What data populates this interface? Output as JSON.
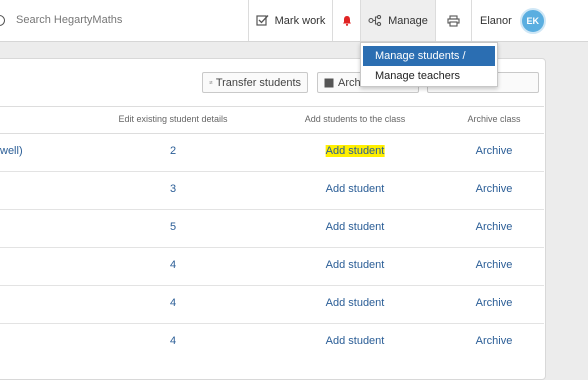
{
  "search": {
    "placeholder": "Search HegartyMaths"
  },
  "nav": {
    "mark_work": "Mark work",
    "manage": "Manage",
    "user_name": "Elanor",
    "user_initials": "EK"
  },
  "dropdown": {
    "items": [
      {
        "label": "Manage students / classes",
        "active": true
      },
      {
        "label": "Manage teachers",
        "active": false
      }
    ]
  },
  "toolbar": {
    "transfer_label": "Transfer students",
    "archive_label": "Archi"
  },
  "table": {
    "headers": [
      "Edit existing student details",
      "Add students to the class",
      "Archive class"
    ],
    "rows": [
      {
        "name": "well)",
        "edit": "2",
        "add": "Add student",
        "archive": "Archive"
      },
      {
        "name": "",
        "edit": "3",
        "add": "Add student",
        "archive": "Archive"
      },
      {
        "name": "",
        "edit": "5",
        "add": "Add student",
        "archive": "Archive"
      },
      {
        "name": "",
        "edit": "4",
        "add": "Add student",
        "archive": "Archive"
      },
      {
        "name": "",
        "edit": "4",
        "add": "Add student",
        "archive": "Archive"
      },
      {
        "name": "",
        "edit": "4",
        "add": "Add student",
        "archive": "Archive"
      }
    ]
  }
}
